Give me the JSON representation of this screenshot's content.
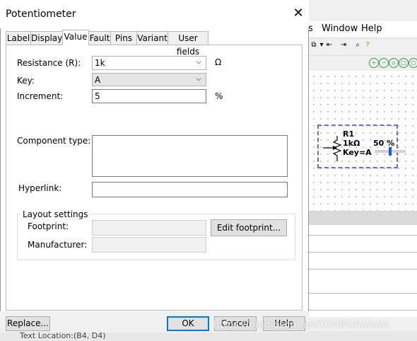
{
  "background_app": {
    "menu": [
      "s",
      "Window",
      "Help"
    ],
    "toolbar_icons": [
      "copy-icon",
      "dropdown-icon",
      "nav-back-icon",
      "nav-forward-icon",
      "zoom-icon",
      "help-icon"
    ],
    "toolbar2_icons": [
      "zoom-in-icon",
      "zoom-out-icon",
      "zoom-area-icon",
      "zoom-page-icon",
      "zoom-fit-icon"
    ],
    "component": {
      "ref": "R1",
      "value": "1kΩ",
      "key": "Key=A",
      "percent": "50 %",
      "slider_fraction": 0.5
    },
    "status_text": "Text Location:(B4, D4)"
  },
  "dialog": {
    "title": "Potentiometer",
    "tabs": [
      {
        "label": "Label",
        "active": false
      },
      {
        "label": "Display",
        "active": false
      },
      {
        "label": "Value",
        "active": true
      },
      {
        "label": "Fault",
        "active": false
      },
      {
        "label": "Pins",
        "active": false
      },
      {
        "label": "Variant",
        "active": false
      },
      {
        "label": "User fields",
        "active": false
      }
    ],
    "fields": {
      "resistance_label": "Resistance (R):",
      "resistance_value": "1k",
      "resistance_unit": "Ω",
      "key_label": "Key:",
      "key_value": "A",
      "increment_label": "Increment:",
      "increment_value": "5",
      "increment_unit": "%",
      "component_type_label": "Component type:",
      "component_type_value": "",
      "hyperlink_label": "Hyperlink:",
      "hyperlink_value": ""
    },
    "layout_settings": {
      "legend": "Layout settings",
      "footprint_label": "Footprint:",
      "footprint_value": "",
      "edit_footprint_button": "Edit footprint...",
      "manufacturer_label": "Manufacturer:",
      "manufacturer_value": ""
    },
    "buttons": {
      "replace": "Replace...",
      "ok": "OK",
      "cancel": "Cancel",
      "help": "Help"
    }
  },
  "watermark": "https://blog.csdn.net/YOUNGAAAAA"
}
